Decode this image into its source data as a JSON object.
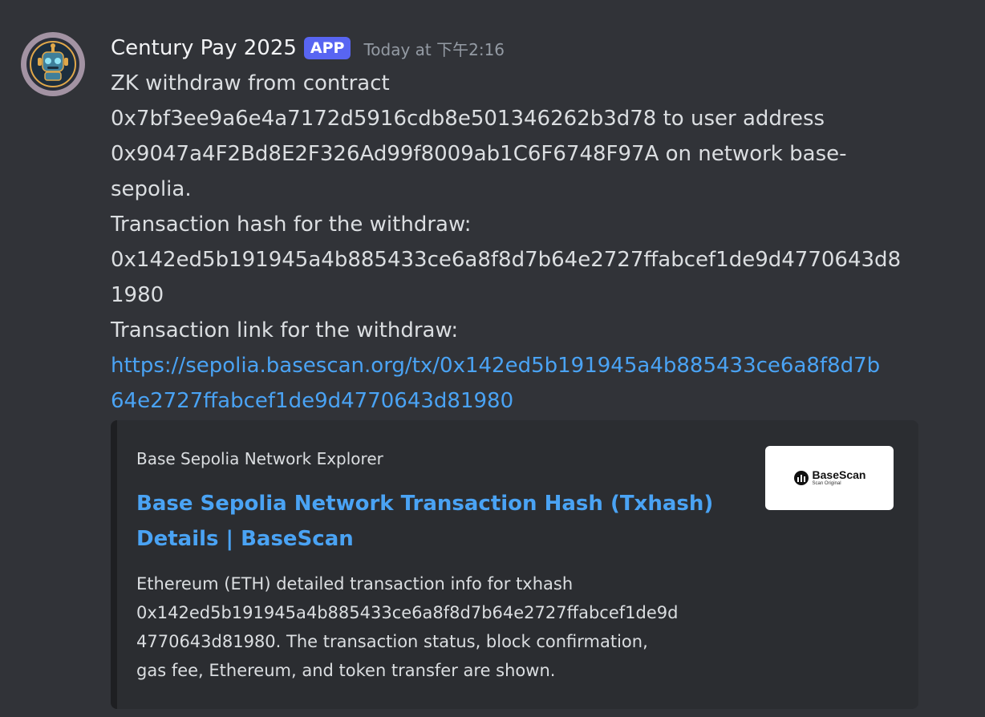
{
  "message": {
    "author": "Century Pay 2025",
    "badge": "APP",
    "timestamp": "Today at 下午2:16",
    "avatar_icon": "robot-avatar-icon",
    "lines": {
      "l1": "ZK withdraw from contract",
      "l2": "0x7bf3ee9a6e4a7172d5916cdb8e501346262b3d78 to user address",
      "l3": "0x9047a4F2Bd8E2F326Ad99f8009ab1C6F6748F97A on network base-",
      "l4": "sepolia.",
      "l5": "Transaction hash for the withdraw:",
      "l6": "0x142ed5b191945a4b885433ce6a8f8d7b64e2727ffabcef1de9d4770643d8",
      "l7": "1980",
      "l8": "Transaction link for the withdraw:"
    },
    "link": {
      "l1": "https://sepolia.basescan.org/tx/0x142ed5b191945a4b885433ce6a8f8d7b",
      "l2": "64e2727ffabcef1de9d4770643d81980"
    }
  },
  "embed": {
    "provider": "Base Sepolia Network Explorer",
    "title_l1": "Base Sepolia Network Transaction Hash (Txhash)",
    "title_l2": "Details | BaseScan",
    "desc": {
      "l1": "Ethereum (ETH) detailed transaction info for txhash",
      "l2": "0x142ed5b191945a4b885433ce6a8f8d7b64e2727ffabcef1de9d",
      "l3": "4770643d81980. The transaction status, block confirmation,",
      "l4": "gas fee, Ethereum, and token transfer are shown."
    },
    "thumbnail": {
      "brand": "BaseScan",
      "sub": "Scan Original"
    }
  },
  "colors": {
    "background": "#313338",
    "embed_bg": "#2b2d31",
    "link": "#4aa3f4",
    "badge": "#5865f2"
  }
}
